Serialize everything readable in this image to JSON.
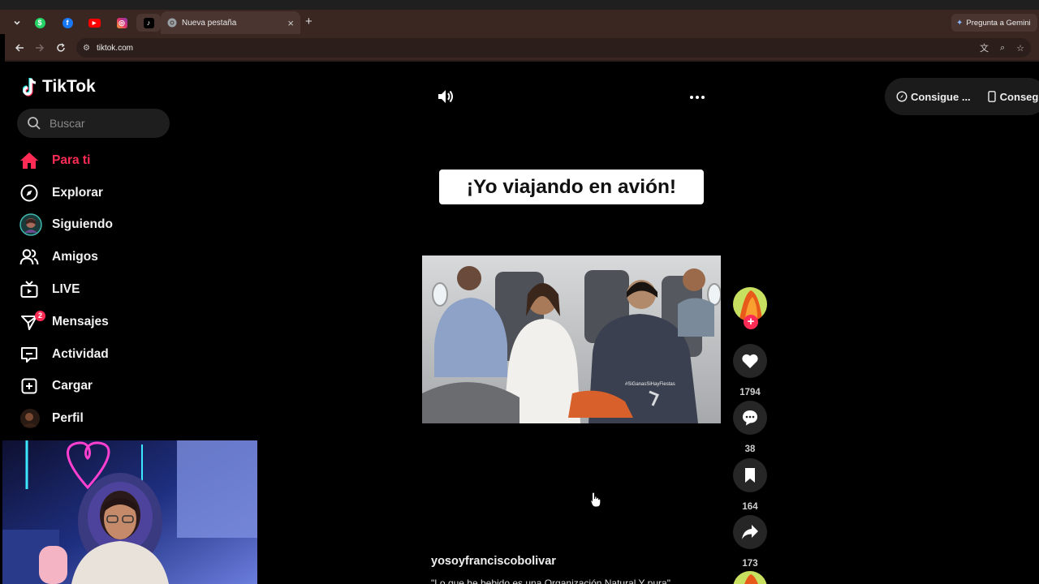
{
  "browser": {
    "pinned_tabs": [
      {
        "name": "whatsapp",
        "color": "#25d366",
        "glyph": "$"
      },
      {
        "name": "facebook",
        "color": "#1877f2",
        "glyph": "f"
      },
      {
        "name": "youtube",
        "color": "#ff0000",
        "glyph": "▶"
      },
      {
        "name": "instagram",
        "color": "#e1306c",
        "glyph": "◎"
      },
      {
        "name": "tiktok",
        "color": "#000000",
        "glyph": "♪"
      }
    ],
    "active_tab": {
      "title": "Nueva pestaña",
      "close": "×"
    },
    "new_tab": "+",
    "gemini_label": "Pregunta a Gemini",
    "url": "tiktok.com"
  },
  "app": {
    "logo": "TikTok",
    "search_placeholder": "Buscar",
    "nav": [
      {
        "label": "Para ti",
        "icon": "home-icon",
        "active": true
      },
      {
        "label": "Explorar",
        "icon": "compass-icon"
      },
      {
        "label": "Siguiendo",
        "icon": "following-avatar-icon"
      },
      {
        "label": "Amigos",
        "icon": "friends-icon"
      },
      {
        "label": "LIVE",
        "icon": "live-tv-icon"
      },
      {
        "label": "Mensajes",
        "icon": "messages-icon",
        "badge": "2"
      },
      {
        "label": "Actividad",
        "icon": "activity-icon"
      },
      {
        "label": "Cargar",
        "icon": "upload-icon"
      },
      {
        "label": "Perfil",
        "icon": "profile-avatar-icon"
      }
    ],
    "accent": "#fe2c55"
  },
  "header": {
    "pill_items": [
      "Consigue ...",
      "Consegu"
    ]
  },
  "video": {
    "caption": "¡Yo viajando en avión!",
    "watermark": "#SiGanasSiHayFiestas",
    "username": "yosoyfranciscobolivar",
    "description": "\"Lo que he bebido es una Organización Natural Y pura\""
  },
  "actions": {
    "likes": "1794",
    "comments": "38",
    "saves": "164",
    "shares": "173"
  }
}
